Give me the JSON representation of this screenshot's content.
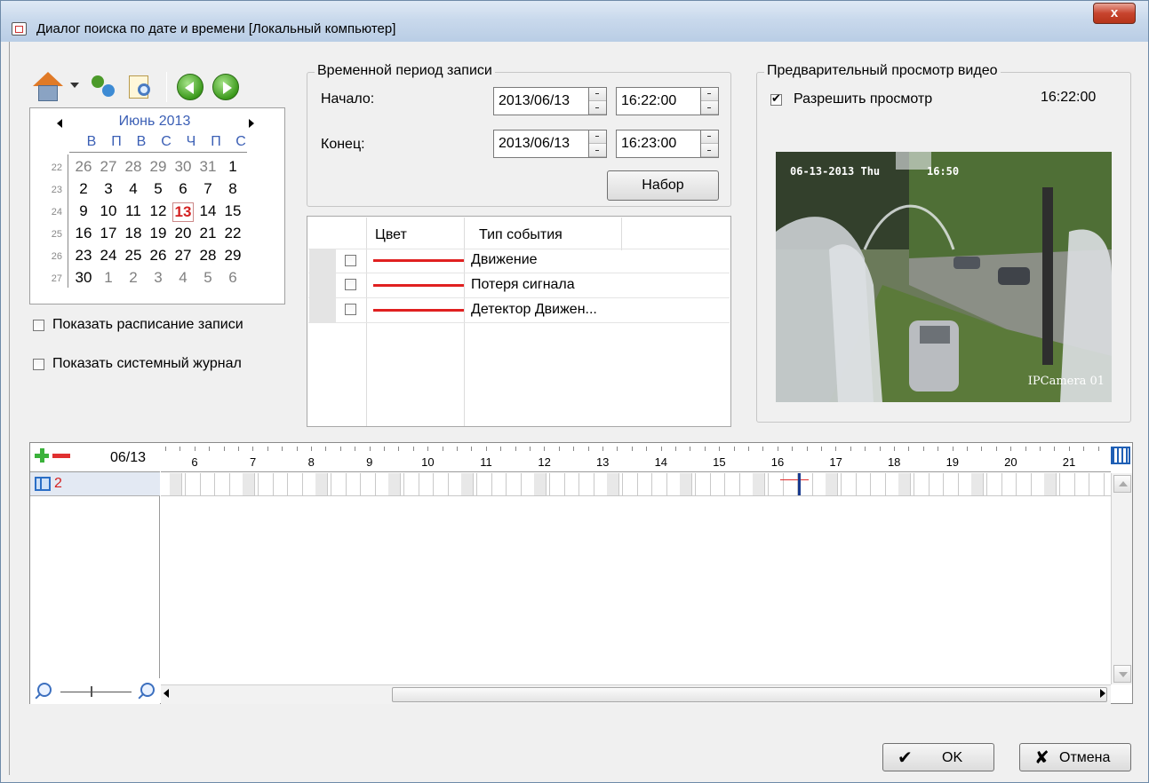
{
  "window": {
    "title": "Диалог поиска по дате и времени [Локальный компьютер]",
    "close_label": "x"
  },
  "toolbar": {
    "icons": [
      "home-icon",
      "dropdown-arrow-icon",
      "search-icon",
      "document-search-icon",
      "previous-icon",
      "next-icon"
    ]
  },
  "calendar": {
    "month": "Июнь 2013",
    "weekdays": [
      "В",
      "П",
      "В",
      "С",
      "Ч",
      "П",
      "С"
    ],
    "weeks": [
      {
        "num": "22",
        "days": [
          "26",
          "27",
          "28",
          "29",
          "30",
          "31",
          "1"
        ]
      },
      {
        "num": "23",
        "days": [
          "2",
          "3",
          "4",
          "5",
          "6",
          "7",
          "8"
        ]
      },
      {
        "num": "24",
        "days": [
          "9",
          "10",
          "11",
          "12",
          "13",
          "14",
          "15"
        ]
      },
      {
        "num": "25",
        "days": [
          "16",
          "17",
          "18",
          "19",
          "20",
          "21",
          "22"
        ]
      },
      {
        "num": "26",
        "days": [
          "23",
          "24",
          "25",
          "26",
          "27",
          "28",
          "29"
        ]
      },
      {
        "num": "27",
        "days": [
          "30",
          "1",
          "2",
          "3",
          "4",
          "5",
          "6"
        ]
      }
    ],
    "selected": "13"
  },
  "options": {
    "show_schedule": "Показать расписание записи",
    "show_syslog": "Показать системный журнал"
  },
  "period": {
    "title": "Временной период записи",
    "start_label": "Начало:",
    "end_label": "Конец:",
    "start_date": "2013/06/13",
    "start_time": "16:22:00",
    "end_date": "2013/06/13",
    "end_time": "16:23:00",
    "set_button": "Набор"
  },
  "events": {
    "columns": [
      "Цвет",
      "Тип события"
    ],
    "rows": [
      {
        "type": "Движение",
        "color": "#e02020",
        "checked": false
      },
      {
        "type": "Потеря сигнала",
        "color": "#e02020",
        "checked": false
      },
      {
        "type": "Детектор Движен...",
        "color": "#e02020",
        "checked": false
      }
    ]
  },
  "preview": {
    "title": "Предварительный просмотр видео",
    "enable_label": "Разрешить просмотр",
    "enable_checked": true,
    "time": "16:22:00",
    "osd_date": "06-13-2013 Thu",
    "osd_time": "16:50",
    "osd_camera": "IPCamera 01"
  },
  "timeline": {
    "date": "06/13",
    "hours": [
      "6",
      "7",
      "8",
      "9",
      "10",
      "11",
      "12",
      "13",
      "14",
      "15",
      "16",
      "17",
      "18",
      "19",
      "20",
      "21"
    ],
    "channel": "2"
  },
  "buttons": {
    "ok": "OK",
    "cancel": "Отмена"
  }
}
